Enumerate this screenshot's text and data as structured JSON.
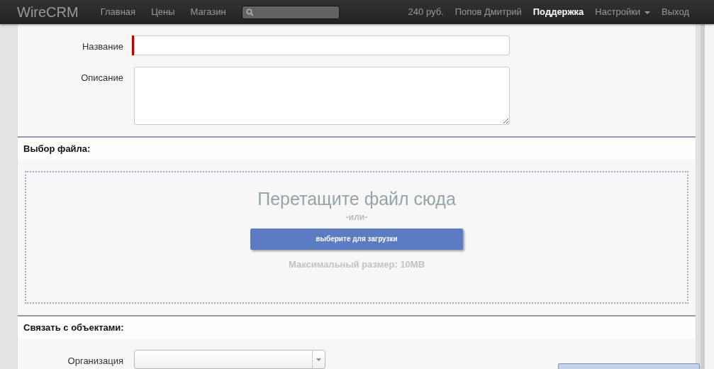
{
  "navbar": {
    "brand": "WireCRM",
    "left_links": [
      {
        "label": "Главная",
        "selected": false
      },
      {
        "label": "Цены",
        "selected": false
      },
      {
        "label": "Магазин",
        "selected": false
      }
    ],
    "right_items": [
      {
        "label": "240 руб.",
        "kind": "text",
        "selected": false
      },
      {
        "label": "Попов Дмитрий",
        "kind": "link",
        "selected": false
      },
      {
        "label": "Поддержка",
        "kind": "link",
        "selected": true
      },
      {
        "label": "Настройки",
        "kind": "dropdown",
        "selected": false
      },
      {
        "label": "Выход",
        "kind": "link",
        "selected": false
      }
    ]
  },
  "fields": [
    {
      "label": "Название",
      "kind": "input",
      "required": true
    },
    {
      "label": "Описание",
      "kind": "textarea",
      "required": false
    }
  ],
  "file_section": {
    "title": "Выбор файла:",
    "drop_text": "Перетащите файл сюда",
    "or_text": "-или-",
    "button": "выберите для загрузки",
    "limit": "Максимальный размер: 10MB"
  },
  "link_section": {
    "title": "Связать с объектами:",
    "fields": [
      {
        "label": "Организация",
        "kind": "select"
      }
    ]
  }
}
